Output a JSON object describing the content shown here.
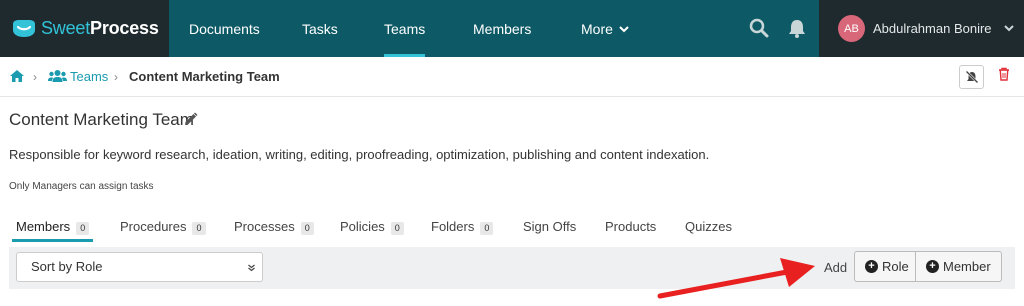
{
  "brand": {
    "part1": "Sweet",
    "part2": "Process"
  },
  "nav": {
    "items": [
      {
        "label": "Documents"
      },
      {
        "label": "Tasks"
      },
      {
        "label": "Teams"
      },
      {
        "label": "Members"
      },
      {
        "label": "More"
      }
    ],
    "active": "Teams"
  },
  "user": {
    "initials": "AB",
    "name": "Abdulrahman Bonire"
  },
  "breadcrumb": {
    "teams": "Teams",
    "current": "Content Marketing Team"
  },
  "team": {
    "title": "Content Marketing Team",
    "description": "Responsible for keyword research, ideation, writing, editing, proofreading, optimization, publishing and content indexation.",
    "note": "Only Managers can assign tasks"
  },
  "tabs": [
    {
      "label": "Members",
      "count": "0"
    },
    {
      "label": "Procedures",
      "count": "0"
    },
    {
      "label": "Processes",
      "count": "0"
    },
    {
      "label": "Policies",
      "count": "0"
    },
    {
      "label": "Folders",
      "count": "0"
    },
    {
      "label": "Sign Offs"
    },
    {
      "label": "Products"
    },
    {
      "label": "Quizzes"
    }
  ],
  "toolbar": {
    "sort_value": "Sort by Role",
    "add_label": "Add",
    "role_button": "Role",
    "member_button": "Member"
  },
  "colors": {
    "nav_bg": "#0d5a66",
    "dark_bg": "#1f2a2e",
    "accent": "#1a9bb0",
    "avatar": "#d9677a",
    "annotation": "#e8201f"
  },
  "icons": [
    "home-icon",
    "users-icon",
    "pencil-icon",
    "search-icon",
    "bell-icon",
    "notification-off-icon",
    "trash-icon",
    "plus-circle-icon",
    "chevron-down-icon"
  ]
}
